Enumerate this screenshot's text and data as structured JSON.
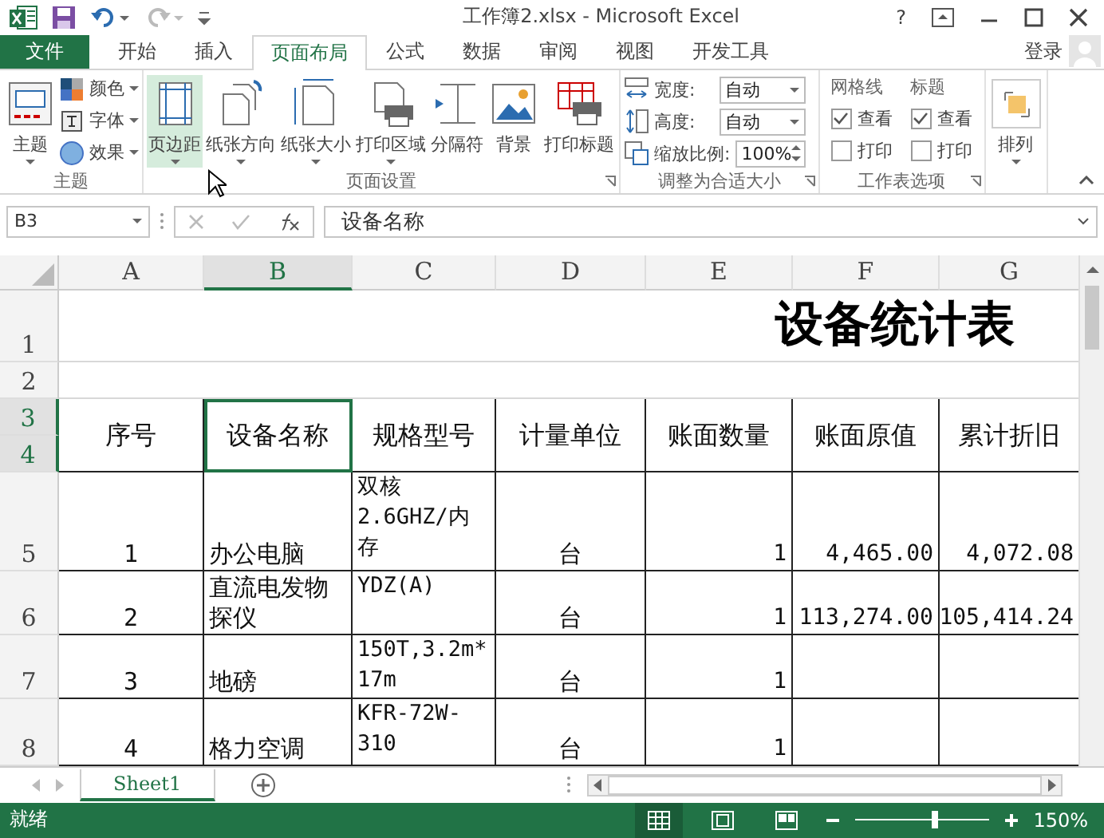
{
  "window": {
    "title": "工作簿2.xlsx - Microsoft Excel",
    "help": "?"
  },
  "ribbon_tabs": [
    {
      "label": "文件",
      "kind": "file",
      "selected": false
    },
    {
      "label": "开始",
      "kind": "tab",
      "selected": false
    },
    {
      "label": "插入",
      "kind": "tab",
      "selected": false
    },
    {
      "label": "页面布局",
      "kind": "tab",
      "selected": true
    },
    {
      "label": "公式",
      "kind": "tab",
      "selected": false
    },
    {
      "label": "数据",
      "kind": "tab",
      "selected": false
    },
    {
      "label": "审阅",
      "kind": "tab",
      "selected": false
    },
    {
      "label": "视图",
      "kind": "tab",
      "selected": false
    },
    {
      "label": "开发工具",
      "kind": "tab",
      "selected": false
    }
  ],
  "account": {
    "label": "登录"
  },
  "ribbon_groups": [
    {
      "title": "主题",
      "launcher": false,
      "kind": "theme",
      "large": [
        {
          "label": "主题",
          "highlighted": false
        }
      ],
      "small": [
        {
          "label": "颜色"
        },
        {
          "label": "字体"
        },
        {
          "label": "效果"
        }
      ]
    },
    {
      "title": "页面设置",
      "launcher": true,
      "kind": "page",
      "large": [
        {
          "label": "页边距",
          "highlighted": true
        },
        {
          "label": "纸张方向",
          "highlighted": false
        },
        {
          "label": "纸张大小",
          "highlighted": false
        },
        {
          "label": "打印区域",
          "highlighted": false
        },
        {
          "label": "分隔符",
          "highlighted": false
        },
        {
          "label": "背景",
          "highlighted": false
        },
        {
          "label": "打印标题",
          "highlighted": false
        }
      ]
    },
    {
      "title": "调整为合适大小",
      "launcher": true,
      "kind": "fit",
      "fields": [
        {
          "label": "宽度:",
          "value": "自动",
          "kind": "dropdown"
        },
        {
          "label": "高度:",
          "value": "自动",
          "kind": "dropdown"
        },
        {
          "label": "缩放比例:",
          "value": "100%",
          "kind": "spinner"
        }
      ]
    },
    {
      "title": "工作表选项",
      "launcher": true,
      "kind": "options",
      "columns": [
        {
          "heading": "网格线",
          "options": [
            {
              "label": "查看",
              "checked": true
            },
            {
              "label": "打印",
              "checked": false
            }
          ]
        },
        {
          "heading": "标题",
          "options": [
            {
              "label": "查看",
              "checked": true
            },
            {
              "label": "打印",
              "checked": false
            }
          ]
        }
      ]
    },
    {
      "launcher": false,
      "kind": "arrange",
      "large": [
        {
          "label": "排列",
          "highlighted": false
        }
      ]
    }
  ],
  "sheet": {
    "name_box": "B3",
    "formula": "设备名称",
    "columns": [
      {
        "label": "A",
        "selected": false
      },
      {
        "label": "B",
        "selected": true
      },
      {
        "label": "C",
        "selected": false
      },
      {
        "label": "D",
        "selected": false
      },
      {
        "label": "E",
        "selected": false
      },
      {
        "label": "F",
        "selected": false
      },
      {
        "label": "G",
        "selected": false
      }
    ],
    "row_headers": [
      {
        "label": "1",
        "selected": false
      },
      {
        "label": "2",
        "selected": false
      },
      {
        "label": "3",
        "selected": true
      },
      {
        "label": "4",
        "selected": true
      },
      {
        "label": "5",
        "selected": false
      },
      {
        "label": "6",
        "selected": false
      },
      {
        "label": "7",
        "selected": false
      },
      {
        "label": "8",
        "selected": false
      }
    ],
    "title": "设备统计表",
    "header": [
      {
        "text": "序号",
        "selected": false
      },
      {
        "text": "设备名称",
        "selected": true
      },
      {
        "text": "规格型号",
        "selected": false
      },
      {
        "text": "计量单位",
        "selected": false
      },
      {
        "text": "账面数量",
        "selected": false
      },
      {
        "text": "账面原值",
        "selected": false
      },
      {
        "text": "累计折旧",
        "selected": false
      }
    ],
    "rows": [
      {
        "cells": [
          "1",
          "办公电脑",
          "双核2.6GHZ/内存",
          "台",
          "1",
          "4,465.00",
          "4,072.08"
        ]
      },
      {
        "cells": [
          "2",
          "直流电发物探仪",
          "YDZ(A)",
          "台",
          "1",
          "113,274.00",
          "105,414.24"
        ]
      },
      {
        "cells": [
          "3",
          "地磅",
          "150T,3.2m*17m",
          "台",
          "1"
        ]
      },
      {
        "cells": [
          "4",
          "格力空调",
          "KFR-72W-310",
          "台",
          "1"
        ]
      }
    ]
  },
  "sheet_tabs": [
    {
      "label": "Sheet1",
      "selected": true
    }
  ],
  "status_bar": {
    "status": "就绪",
    "zoom": "150%",
    "zoom_level": {
      "level": 0.6
    }
  }
}
